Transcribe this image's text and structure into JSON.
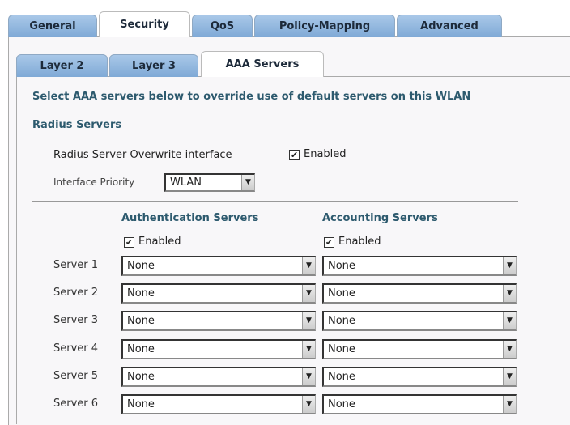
{
  "tabs": [
    {
      "label": "General"
    },
    {
      "label": "Security"
    },
    {
      "label": "QoS"
    },
    {
      "label": "Policy-Mapping"
    },
    {
      "label": "Advanced"
    }
  ],
  "subtabs": [
    {
      "label": "Layer 2"
    },
    {
      "label": "Layer 3"
    },
    {
      "label": "AAA Servers"
    }
  ],
  "intro": "Select AAA servers below to override use of default servers on this WLAN",
  "radius_heading": "Radius Servers",
  "overwrite": {
    "label": "Radius Server Overwrite interface",
    "checkbox_label": "Enabled",
    "checked": true
  },
  "priority": {
    "label": "Interface Priority",
    "value": "WLAN"
  },
  "auth": {
    "heading": "Authentication Servers",
    "enabled_label": "Enabled",
    "checked": true
  },
  "acct": {
    "heading": "Accounting Servers",
    "enabled_label": "Enabled",
    "checked": true
  },
  "servers": [
    {
      "label": "Server 1",
      "auth": "None",
      "acct": "None"
    },
    {
      "label": "Server 2",
      "auth": "None",
      "acct": "None"
    },
    {
      "label": "Server 3",
      "auth": "None",
      "acct": "None"
    },
    {
      "label": "Server 4",
      "auth": "None",
      "acct": "None"
    },
    {
      "label": "Server 5",
      "auth": "None",
      "acct": "None"
    },
    {
      "label": "Server 6",
      "auth": "None",
      "acct": "None"
    }
  ],
  "icons": {
    "check": "✔",
    "dropdown": "▼"
  }
}
